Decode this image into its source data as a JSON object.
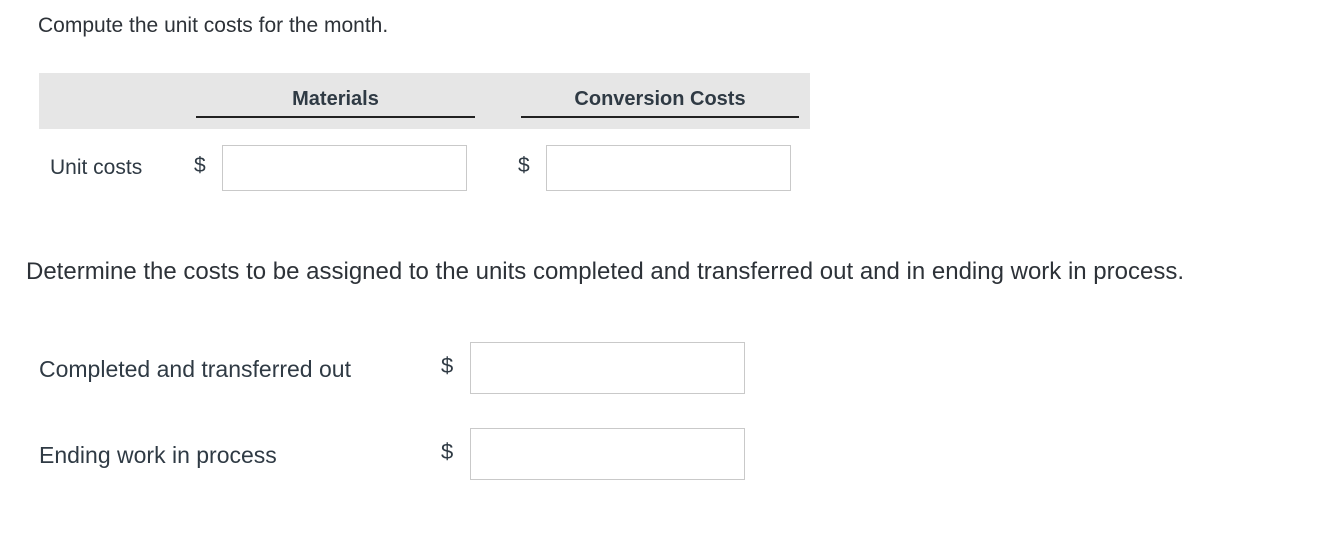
{
  "section1": {
    "prompt": "Compute the unit costs for the month.",
    "columns": [
      "Materials",
      "Conversion Costs"
    ],
    "row": {
      "label": "Unit costs",
      "currency": "$",
      "materials_value": "",
      "conversion_value": ""
    }
  },
  "section2": {
    "prompt": "Determine the costs to be assigned to the units completed and transferred out and in ending work in process.",
    "rows": [
      {
        "label": "Completed and transferred out",
        "currency": "$",
        "value": ""
      },
      {
        "label": "Ending work in process",
        "currency": "$",
        "value": ""
      }
    ]
  }
}
